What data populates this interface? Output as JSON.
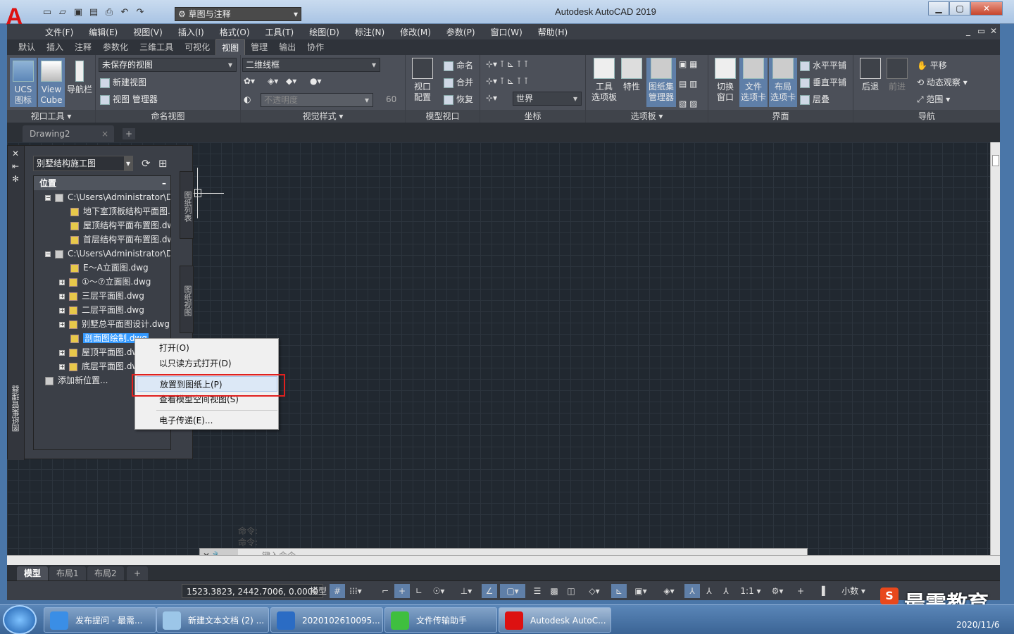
{
  "window": {
    "title": "Autodesk AutoCAD 2019",
    "app_logo": "A"
  },
  "quick_access": {
    "workspace": "草图与注释"
  },
  "menubar": [
    "文件(F)",
    "编辑(E)",
    "视图(V)",
    "插入(I)",
    "格式(O)",
    "工具(T)",
    "绘图(D)",
    "标注(N)",
    "修改(M)",
    "参数(P)",
    "窗口(W)",
    "帮助(H)"
  ],
  "ribbon_tabs": [
    "默认",
    "插入",
    "注释",
    "参数化",
    "三维工具",
    "可视化",
    "视图",
    "管理",
    "输出",
    "协作"
  ],
  "ribbon_active_tab": "视图",
  "ribbon": {
    "viewport_tools": {
      "title": "视口工具",
      "ucs": "UCS\n图标",
      "viewcube": "View\nCube",
      "navbar": "导航栏"
    },
    "named_views": {
      "title": "命名视图",
      "dropdown": "未保存的视图",
      "new_view": "新建视图",
      "view_manager": "视图 管理器"
    },
    "visual_styles": {
      "title": "视觉样式",
      "dropdown": "二维线框",
      "opacity_placeholder": "不透明度",
      "opacity_value": "60"
    },
    "model_viewports": {
      "title": "模型视口",
      "viewport_config": "视口\n配置",
      "name": "命名",
      "join": "合并",
      "restore": "恢复"
    },
    "coordinates": {
      "title": "坐标",
      "world": "世界"
    },
    "palettes": {
      "title": "选项板",
      "tool_palettes": "工具\n选项板",
      "properties": "特性",
      "sheetset_mgr": "图纸集\n管理器"
    },
    "interface": {
      "title": "界面",
      "switch_window": "切换\n窗口",
      "file_tabs": "文件\n选项卡",
      "layout_tabs": "布局\n选项卡",
      "tile_h": "水平平铺",
      "tile_v": "垂直平铺",
      "cascade": "层叠"
    },
    "navigate": {
      "title": "导航",
      "back": "后退",
      "forward": "前进",
      "pan": "平移",
      "orbit": "动态观察",
      "extents": "范围"
    }
  },
  "file_tab": {
    "name": "Drawing2",
    "close": "×",
    "add": "+"
  },
  "sheetset": {
    "palette_title": "图纸集管理器",
    "dropdown": "别墅结构施工图",
    "section_title": "位置",
    "side_tabs": [
      "图纸列表",
      "图纸视图"
    ],
    "tree": [
      {
        "level": 0,
        "exp": "−",
        "type": "folder",
        "text": "C:\\Users\\Administrator\\De"
      },
      {
        "level": 1,
        "exp": "",
        "type": "file",
        "text": "地下室顶板结构平面图.dv"
      },
      {
        "level": 1,
        "exp": "",
        "type": "file",
        "text": "屋顶结构平面布置图.dwg"
      },
      {
        "level": 1,
        "exp": "",
        "type": "file",
        "text": "首层结构平面布置图.dwg"
      },
      {
        "level": 0,
        "exp": "−",
        "type": "folder",
        "text": "C:\\Users\\Administrator\\De"
      },
      {
        "level": 1,
        "exp": "",
        "type": "file",
        "text": "E～A立面图.dwg"
      },
      {
        "level": 1,
        "exp": "+",
        "type": "file",
        "text": "①～⑦立面图.dwg"
      },
      {
        "level": 1,
        "exp": "+",
        "type": "file",
        "text": "三层平面图.dwg"
      },
      {
        "level": 1,
        "exp": "+",
        "type": "file",
        "text": "二层平面图.dwg"
      },
      {
        "level": 1,
        "exp": "+",
        "type": "file",
        "text": "别墅总平面图设计.dwg"
      },
      {
        "level": 1,
        "exp": "",
        "type": "file",
        "text": "剖面图绘制.dwg",
        "selected": true
      },
      {
        "level": 1,
        "exp": "+",
        "type": "file",
        "text": "屋顶平面图.dwg"
      },
      {
        "level": 1,
        "exp": "+",
        "type": "file",
        "text": "底层平面图.dwg"
      },
      {
        "level": 0,
        "exp": "",
        "type": "add",
        "text": "添加新位置..."
      }
    ]
  },
  "context_menu": {
    "items": [
      "打开(O)",
      "以只读方式打开(D)",
      "放置到图纸上(P)",
      "查看模型空间视图(S)",
      "电子传递(E)..."
    ],
    "highlighted": "放置到图纸上(P)"
  },
  "command": {
    "history": [
      "命令:",
      "命令:"
    ],
    "placeholder": "键入命令"
  },
  "layout_tabs": [
    "模型",
    "布局1",
    "布局2",
    "+"
  ],
  "statusbar": {
    "coords": "1523.3823, 2442.7006, 0.0000",
    "model": "模型",
    "scale": "1:1",
    "units": "小数"
  },
  "taskbar": {
    "items": [
      "发布提问 - 最需...",
      "新建文本文档 (2) ...",
      "2020102610095...",
      "文件传输助手",
      "Autodesk AutoC..."
    ],
    "date": "2020/11/6"
  },
  "watermark": {
    "badge": "S",
    "text": "最需教育"
  },
  "colors": {
    "canvas": "#212830",
    "ribbon": "#4c5059",
    "selection": "#3399ff",
    "redbox": "#e0201e"
  }
}
